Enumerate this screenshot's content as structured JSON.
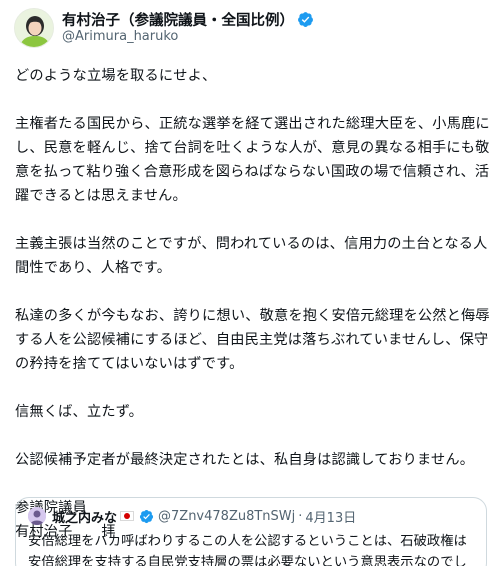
{
  "tweet": {
    "display_name": "有村治子（参議院議員・全国比例）",
    "handle": "@Arimura_haruko",
    "verified_color": "#1d9bf0",
    "paragraphs": [
      "どのような立場を取るにせよ、",
      "主権者たる国民から、正統な選挙を経て選出された総理大臣を、小馬鹿にし、民意を軽んじ、捨て台詞を吐くような人が、意見の異なる相手にも敬意を払って粘り強く合意形成を図らねばならない国政の場で信頼され、活躍できるとは思えません。",
      "主義主張は当然のことですが、問われているのは、信用力の土台となる人間性であり、人格です。",
      "私達の多くが今もなお、誇りに想い、敬意を抱く安倍元総理を公然と侮辱する人を公認候補にするほど、自由民主党は落ちぶれていませんし、保守の矜持を捨ててはいないはずです。",
      "信無くば、立たず。",
      "公認候補予定者が最終決定されたとは、私自身は認識しておりません。",
      "参議院議員\n有村治子　　拝"
    ]
  },
  "quoted": {
    "display_name": "城之内みな",
    "flag": "japan-flag",
    "handle": "@7Znv478Zu8TnSWj",
    "separator": "·",
    "date": "4月13日",
    "text": "安倍総理をバカ呼ばわりするこの人を公認するということは、石破政権は安倍総理を支持する自民党支持層の票は必要ないという意思表示なのでしょうか？"
  }
}
